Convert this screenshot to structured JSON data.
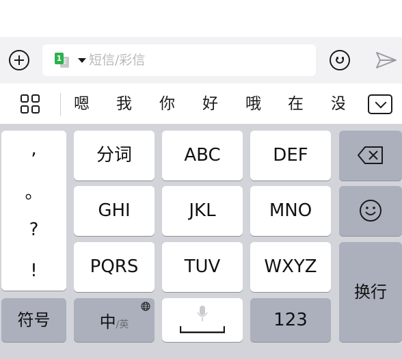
{
  "compose": {
    "add_icon": "plus-circle-icon",
    "sim_indicator": {
      "primary": "1",
      "secondary": "2",
      "icon": "dual-sim-icon"
    },
    "message_placeholder": "短信/彩信",
    "emoji_icon": "smiley-icon",
    "send_icon": "send-arrow-icon"
  },
  "candidates": {
    "menu_icon": "grid-icon",
    "items": [
      "嗯",
      "我",
      "你",
      "好",
      "哦",
      "在",
      "没"
    ],
    "collapse_icon": "chevron-down-icon"
  },
  "keyboard": {
    "punctuation": [
      ",",
      "。",
      "?",
      "!"
    ],
    "keys": {
      "fenci": "分词",
      "abc": "ABC",
      "def": "DEF",
      "ghi": "GHI",
      "jkl": "JKL",
      "mno": "MNO",
      "pqrs": "PQRS",
      "tuv": "TUV",
      "wxyz": "WXYZ",
      "symbol": "符号",
      "lang_main": "中",
      "lang_alt": "/英",
      "num": "123",
      "enter": "换行"
    },
    "icons": {
      "backspace": "backspace-icon",
      "emoji": "smiley-icon",
      "globe": "globe-icon",
      "mic": "microphone-icon",
      "space": "space-bar-icon"
    },
    "colors": {
      "background": "#d2d4da",
      "light_key": "#ffffff",
      "dark_key": "#abb0bc",
      "sim_green": "#2bb24c"
    }
  }
}
